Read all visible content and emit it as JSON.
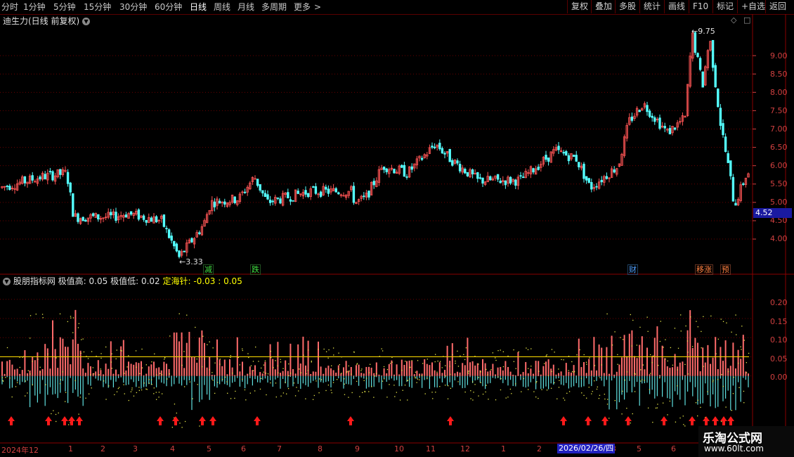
{
  "topbar": {
    "left_items": [
      "分时",
      "1分钟",
      "5分钟",
      "15分钟",
      "30分钟",
      "60分钟",
      "日线",
      "周线",
      "月线",
      "多周期",
      "更多"
    ],
    "active_item": "日线",
    "more_arrow": ">",
    "right_items": [
      "复权",
      "叠加",
      "多股",
      "统计",
      "画线",
      "F10",
      "标记",
      "+自选",
      "返回"
    ]
  },
  "main_chart": {
    "title": "迪生力(日线 前复权)",
    "high_label": "9.75",
    "low_label": "3.33",
    "current_price": "4.52",
    "y_ticks": [
      "9.00",
      "8.50",
      "8.00",
      "7.50",
      "7.00",
      "6.50",
      "6.00",
      "5.50",
      "5.00",
      "4.50",
      "4.00"
    ],
    "events": [
      {
        "text": "减",
        "color": "#40e040"
      },
      {
        "text": "跌",
        "color": "#40e040"
      },
      {
        "text": "财",
        "color": "#4fa0ff"
      },
      {
        "text": "移涨",
        "color": "#ff8040"
      },
      {
        "text": "预",
        "color": "#ff8040"
      }
    ],
    "colors": {
      "up": "#ff5555",
      "down": "#54ffff",
      "grid": "#6a0000"
    }
  },
  "indicator": {
    "name": "股朋指标网",
    "high_label": "极值高:",
    "high_value": "0.05",
    "low_label": "极值低:",
    "low_value": "0.02",
    "needle_label": "定海针:",
    "needle_values": "-0.03 : 0.05",
    "y_ticks": [
      "0.20",
      "0.15",
      "0.10",
      "0.05",
      "0.00"
    ]
  },
  "x_axis": {
    "labels": [
      "2024年12",
      "1",
      "2",
      "3",
      "4",
      "5",
      "6",
      "7",
      "8",
      "9",
      "10",
      "11",
      "12",
      "1",
      "2",
      "3",
      "4",
      "5",
      "6"
    ],
    "date_badge": "2026/02/26/四"
  },
  "watermark": {
    "title": "乐淘公式网",
    "url": "www.60lt.com"
  }
}
